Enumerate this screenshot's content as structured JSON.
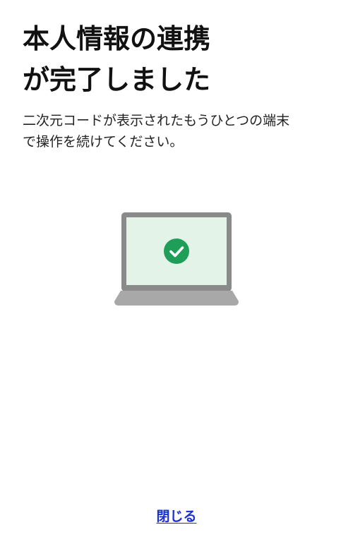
{
  "title": {
    "line1": "本人情報の連携",
    "line2": "が完了しました"
  },
  "description": {
    "line1": "二次元コードが表示されたもうひとつの端末",
    "line2": "で操作を続けてください。"
  },
  "illustration": {
    "icon": "laptop-check-icon",
    "colors": {
      "frame": "#8a8a8a",
      "base": "#a8a8a8",
      "screen": "#e3f3e8",
      "check_circle": "#1f9e5a",
      "check_mark": "#ffffff"
    }
  },
  "actions": {
    "close_label": "閉じる",
    "link_color": "#1b2fd6"
  }
}
